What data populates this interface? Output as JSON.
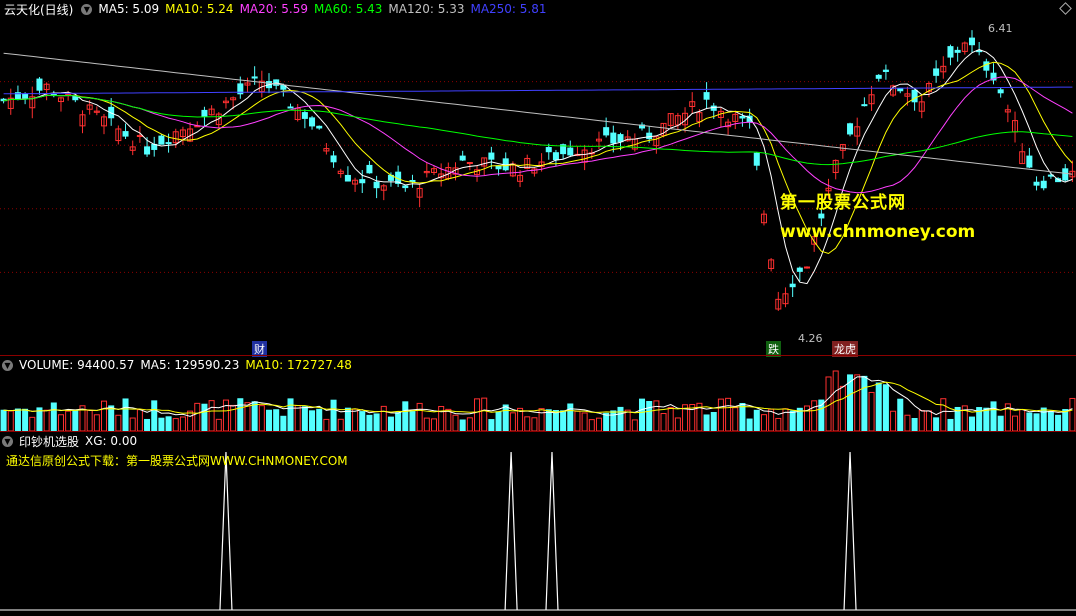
{
  "main": {
    "title": "云天化(日线)",
    "ma": [
      {
        "label": "MA5: 5.09",
        "color": "#ffffff"
      },
      {
        "label": "MA10: 5.24",
        "color": "#ffff00"
      },
      {
        "label": "MA20: 5.59",
        "color": "#ff40ff"
      },
      {
        "label": "MA60: 5.43",
        "color": "#00ff00"
      },
      {
        "label": "MA120: 5.33",
        "color": "#c0c0c0"
      },
      {
        "label": "MA250: 5.81",
        "color": "#4040ff"
      }
    ],
    "high_label": "6.41",
    "low_label": "4.26",
    "badges": {
      "cai": "财",
      "die": "跌",
      "longhu": "龙虎"
    },
    "watermark_cn": "第一股票公式网",
    "watermark_url": "www.chnmoney.com"
  },
  "volume": {
    "label": "VOLUME: 94400.57",
    "ma5": "MA5: 129590.23",
    "ma10": "MA10: 172727.48"
  },
  "indicator": {
    "label": "印钞机选股",
    "xg": "XG: 0.00",
    "note": "通达信原创公式下载：第一股票公式网WWW.CHNMONEY.COM"
  },
  "colors": {
    "up": "#ff3030",
    "down": "#54ffff",
    "grid": "#8b0000"
  },
  "chart_data": {
    "type": "candlestick",
    "title": "云天化(日线)",
    "price_high": 6.41,
    "price_low": 4.26,
    "ma_last": {
      "MA5": 5.09,
      "MA10": 5.24,
      "MA20": 5.59,
      "MA60": 5.43,
      "MA120": 5.33,
      "MA250": 5.81
    },
    "volume_last": 94400.57,
    "volume_ma5": 129590.23,
    "volume_ma10": 172727.48,
    "xg_last": 0.0,
    "signal_bar_fractions": [
      0.21,
      0.475,
      0.513,
      0.79
    ]
  }
}
